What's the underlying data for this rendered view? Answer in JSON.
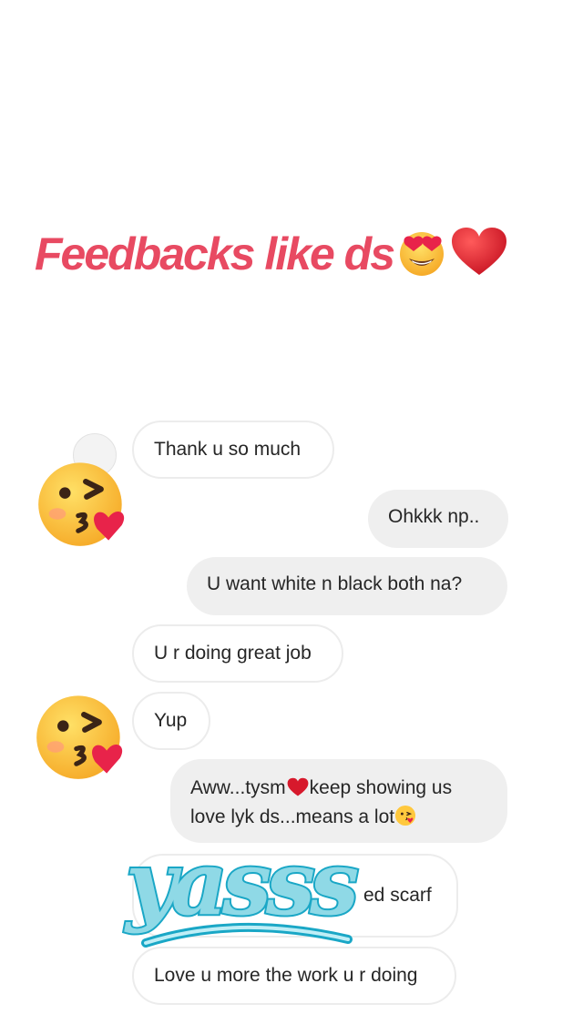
{
  "headline": {
    "text": "Feedbacks like ds",
    "emojis": [
      "heart-eyes-emoji",
      "red-heart-icon"
    ]
  },
  "messages": [
    {
      "direction": "incoming",
      "text": "Thank u so much"
    },
    {
      "direction": "outgoing",
      "text": "Ohkkk np.."
    },
    {
      "direction": "outgoing",
      "text": "U want white n black both na?"
    },
    {
      "direction": "incoming",
      "text": "U r doing great job"
    },
    {
      "direction": "incoming",
      "text": "Yup"
    },
    {
      "direction": "outgoing",
      "line1_a": "Aww...tysm",
      "line1_b": "keep showing us",
      "line2": "love lyk ds...means a lot",
      "emojis": [
        "red-heart-icon",
        "kissing-face-emoji"
      ]
    },
    {
      "direction": "incoming",
      "text": "ed scarf"
    },
    {
      "direction": "incoming",
      "text": "Love u more the work u r doing"
    }
  ],
  "sticker": {
    "text": "yasss",
    "icon": "yasss-sticker"
  },
  "overlay_emojis": [
    "kissing-face-emoji",
    "kissing-face-emoji"
  ],
  "colors": {
    "headline": "#e84a62",
    "outgoing_bubble": "#efefef",
    "incoming_border": "#ececec",
    "sticker_fill": "#8fd9e6",
    "sticker_stroke": "#1aa7c6",
    "heart": "#d7192c",
    "emoji_face": "#ffc83d"
  }
}
